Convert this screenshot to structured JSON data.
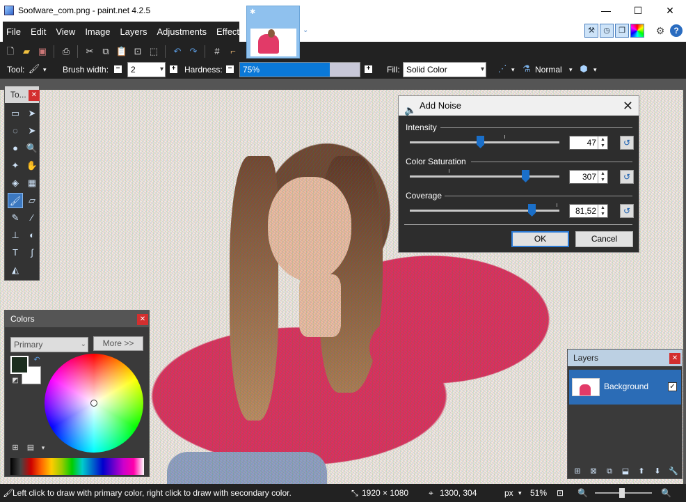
{
  "window": {
    "title": "Soofware_com.png - paint.net 4.2.5",
    "minimize_icon": "—",
    "maximize_icon": "☐",
    "close_icon": "✕"
  },
  "menu": [
    "File",
    "Edit",
    "View",
    "Image",
    "Layers",
    "Adjustments",
    "Effects"
  ],
  "toolbar": {
    "tool_label": "Tool:",
    "brush_width_label": "Brush width:",
    "brush_width_value": "2",
    "hardness_label": "Hardness:",
    "hardness_value": "75%",
    "hardness_percent": 75,
    "fill_label": "Fill:",
    "fill_value": "Solid Color",
    "blend_mode": "Normal"
  },
  "tools_panel": {
    "title": "To..."
  },
  "colors_panel": {
    "title": "Colors",
    "mode": "Primary",
    "more_button": "More >>",
    "primary_color": "#1b2d1e",
    "secondary_color": "#ffffff"
  },
  "dialog": {
    "title": "Add Noise",
    "intensity": {
      "label": "Intensity",
      "value": "47",
      "fraction": 0.47
    },
    "color_saturation": {
      "label": "Color Saturation",
      "value": "307",
      "fraction": 0.77
    },
    "coverage": {
      "label": "Coverage",
      "value": "81,52",
      "fraction": 0.8152
    },
    "ok_button": "OK",
    "cancel_button": "Cancel"
  },
  "layers_panel": {
    "title": "Layers",
    "layers": [
      {
        "name": "Background",
        "visible": true
      }
    ]
  },
  "status": {
    "hint": "Left click to draw with primary color, right click to draw with secondary color.",
    "image_size": "1920 × 1080",
    "cursor_pos": "1300, 304",
    "units": "px",
    "zoom": "51%"
  },
  "colors": {
    "accent": "#0a78d7",
    "close_red": "#d32f2f",
    "selection": "#2b6cb6"
  }
}
